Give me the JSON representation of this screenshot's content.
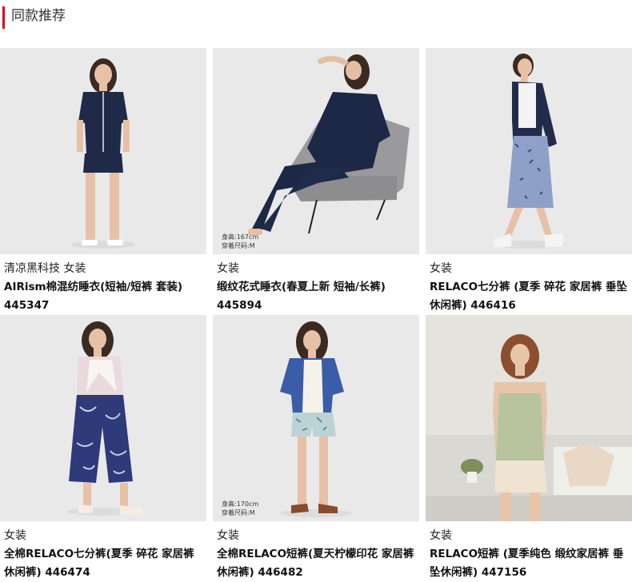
{
  "section": {
    "title": "同款推荐"
  },
  "products": [
    {
      "category": "清凉黑科技 女装",
      "name": "AIRism棉混纺睡衣(短袖/短裤 套装)",
      "code": "445347",
      "size_hint": null
    },
    {
      "category": "女装",
      "name": "缎纹花式睡衣(春夏上新 短袖/长裤)",
      "code": "445894",
      "size_hint": [
        "身高:167cm",
        "穿着尺码:M"
      ]
    },
    {
      "category": "女装",
      "name": "RELACO七分裤 (夏季 碎花 家居裤 垂坠休闲裤)",
      "code": "446416",
      "size_hint": null
    },
    {
      "category": "女装",
      "name": "全棉RELACO七分裤(夏季 碎花 家居裤 休闲裤)",
      "code": "446474",
      "size_hint": null
    },
    {
      "category": "女装",
      "name": "全棉RELACO短裤(夏天柠檬印花 家居裤 休闲裤)",
      "code": "446482",
      "size_hint": [
        "身高:170cm",
        "穿着尺码:M"
      ]
    },
    {
      "category": "女装",
      "name": "RELACO短裤 (夏季纯色 缎纹家居裤 垂坠休闲裤)",
      "code": "447156",
      "size_hint": null
    }
  ]
}
